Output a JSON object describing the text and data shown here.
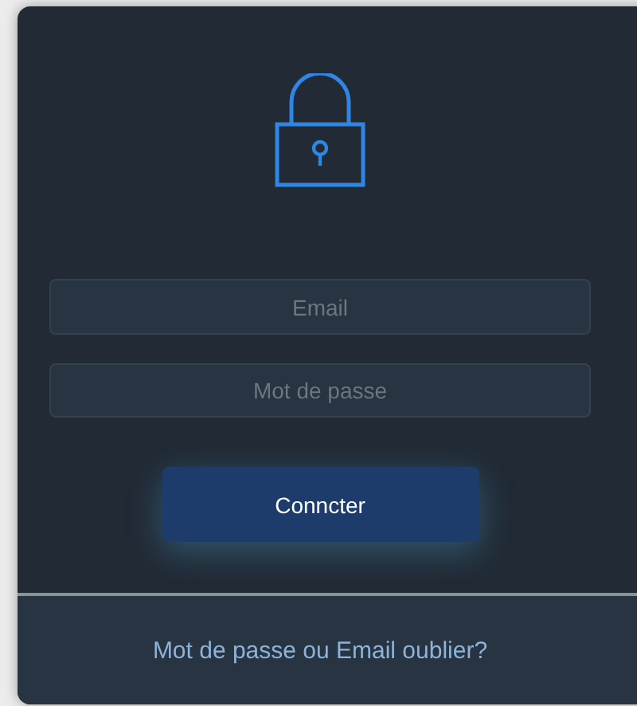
{
  "login": {
    "email": {
      "placeholder": "Email"
    },
    "password": {
      "placeholder": "Mot de passe"
    },
    "submit": "Conncter",
    "forgot_link": "Mot de passe ou Email oublier?"
  }
}
